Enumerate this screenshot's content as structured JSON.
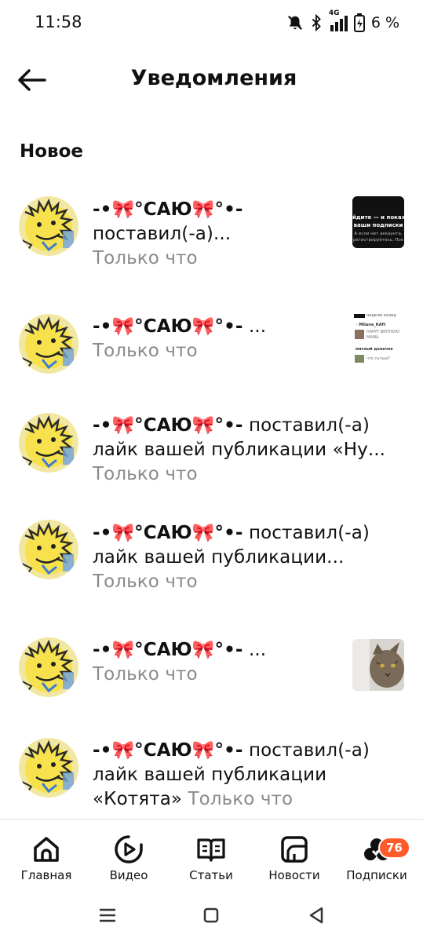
{
  "status_bar": {
    "time": "11:58",
    "network": "4G",
    "battery": "6 %"
  },
  "header": {
    "title": "Уведомления"
  },
  "section": {
    "title": "Новое"
  },
  "notifications": [
    {
      "name": "-•🎀°САЮ🎀°•-",
      "action_line1": "",
      "action": "поставил(-а)...",
      "time": "Только что",
      "has_thumb": true,
      "thumb": "black-card"
    },
    {
      "name": "-•🎀°САЮ🎀°•-",
      "action_line1": "",
      "action": "...",
      "time": "Только что",
      "has_thumb": true,
      "thumb": "list-card"
    },
    {
      "name": "-•🎀°САЮ🎀°•-",
      "action": "поставил(-а) лайк вашей публикации «Ну...",
      "time": "Только что",
      "has_thumb": false
    },
    {
      "name": "-•🎀°САЮ🎀°•-",
      "action": "поставил(-а) лайк вашей публикации...",
      "time": "Только что",
      "has_thumb": false
    },
    {
      "name": "-•🎀°САЮ🎀°•-",
      "action": "...",
      "time": "Только что",
      "has_thumb": true,
      "thumb": "cat-photo"
    },
    {
      "name": "-•🎀°САЮ🎀°•-",
      "action": "поставил(-а) лайк вашей публикации «Котята»",
      "time": "Только что",
      "has_thumb": false
    }
  ],
  "thumb_text": {
    "black_card_line1": "йдите — и покаже",
    "black_card_line2": "ваши подписки",
    "black_card_line3": "А если нет аккаунта,",
    "black_card_line4": "регистрируйтесь. Пок",
    "list_line1": "неделю колид",
    "list_line2": "♡Milana_КАft",
    "list_line3": "HAPPY BIRTHDAY",
    "list_line4": "МАМА",
    "list_line5": "мятный денечек",
    "list_line6": "что лучше?"
  },
  "bottom_nav": {
    "items": [
      {
        "label": "Главная",
        "icon": "home-icon"
      },
      {
        "label": "Видео",
        "icon": "video-icon"
      },
      {
        "label": "Статьи",
        "icon": "articles-icon"
      },
      {
        "label": "Новости",
        "icon": "news-icon"
      },
      {
        "label": "Подписки",
        "icon": "subscriptions-icon"
      }
    ],
    "badge": "76"
  },
  "colors": {
    "badge": "#ff5a2a",
    "time_text": "#8a8a8a",
    "text": "#111111"
  }
}
